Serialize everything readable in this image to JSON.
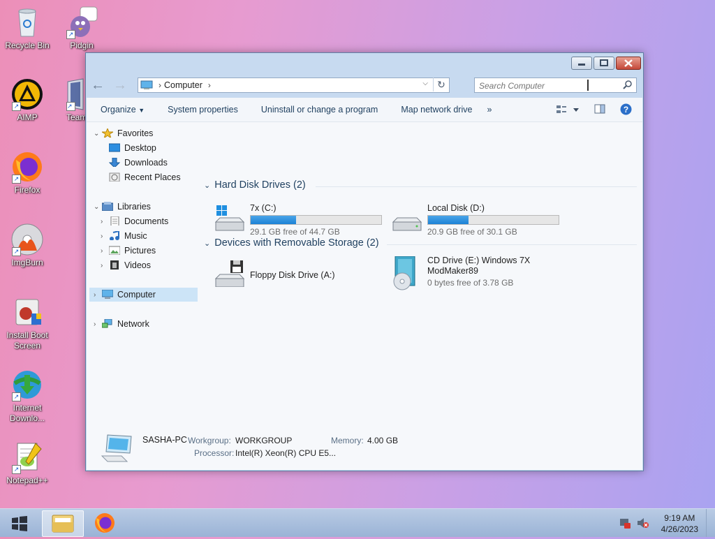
{
  "desktop": {
    "icons": [
      {
        "label": "Recycle Bin"
      },
      {
        "label": "Pidgin"
      },
      {
        "label": "AIMP"
      },
      {
        "label": "Team"
      },
      {
        "label": "Firefox"
      },
      {
        "label": "ImgBurn"
      },
      {
        "label": "Install Boot Screen"
      },
      {
        "label": "Internet Downlo..."
      },
      {
        "label": "Notepad++"
      }
    ]
  },
  "window": {
    "address": {
      "location": "Computer"
    },
    "search": {
      "placeholder": "Search Computer"
    },
    "toolbar": {
      "organize": "Organize",
      "system_properties": "System properties",
      "uninstall": "Uninstall or change a program",
      "map_drive": "Map network drive",
      "more": "»"
    },
    "nav": {
      "favorites": "Favorites",
      "desktop": "Desktop",
      "downloads": "Downloads",
      "recent_places": "Recent Places",
      "libraries": "Libraries",
      "documents": "Documents",
      "music": "Music",
      "pictures": "Pictures",
      "videos": "Videos",
      "computer": "Computer",
      "network": "Network"
    },
    "groups": {
      "hard_disks": {
        "header": "Hard Disk Drives (2)",
        "drives": [
          {
            "name": "7x (C:)",
            "free_text": "29.1 GB free of 44.7 GB",
            "used_fraction": 0.35
          },
          {
            "name": "Local Disk (D:)",
            "free_text": "20.9 GB free of 30.1 GB",
            "used_fraction": 0.31
          }
        ]
      },
      "removable": {
        "header": "Devices with Removable Storage (2)",
        "devices": [
          {
            "name": "Floppy Disk Drive (A:)"
          },
          {
            "name_line1": "CD Drive (E:) Windows 7X",
            "name_line2": "ModMaker89",
            "free_text": "0 bytes free of 3.78 GB"
          }
        ]
      }
    },
    "details": {
      "pc_name": "SASHA-PC",
      "workgroup_label": "Workgroup:",
      "workgroup": "WORKGROUP",
      "memory_label": "Memory:",
      "memory": "4.00 GB",
      "processor_label": "Processor:",
      "processor": "Intel(R) Xeon(R) CPU E5..."
    }
  },
  "taskbar": {
    "time": "9:19 AM",
    "date": "4/26/2023"
  },
  "colors": {
    "accent": "#1c82d6",
    "selection": "#cce4f7"
  }
}
